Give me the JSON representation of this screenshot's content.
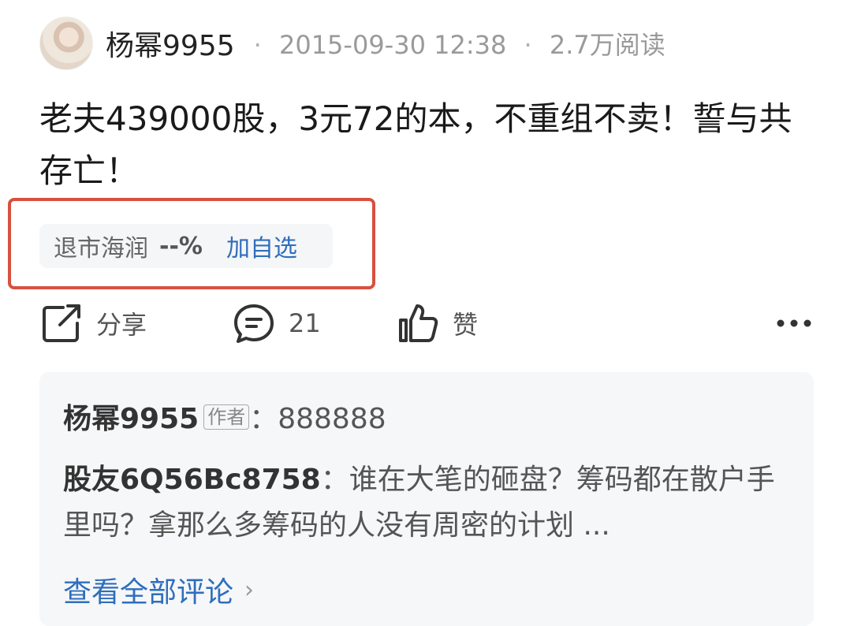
{
  "header": {
    "author": "杨幂9955",
    "separator": "·",
    "timestamp": "2015-09-30 12:38",
    "views": "2.7万阅读"
  },
  "post": {
    "text": "老夫439000股，3元72的本，不重组不卖！誓与共存亡！"
  },
  "stock": {
    "name": "退市海润",
    "change": "--%",
    "add_label": "加自选"
  },
  "actions": {
    "share_label": "分享",
    "comment_count": "21",
    "like_label": "赞"
  },
  "comments": {
    "items": [
      {
        "user": "杨幂9955",
        "tag": "作者",
        "separator": "：",
        "text": "888888"
      },
      {
        "user": "股友6Q56Bc8758",
        "separator": "：",
        "text": "谁在大笔的砸盘？筹码都在散户手里吗？拿那么多筹码的人没有周密的计划 ..."
      }
    ],
    "view_all": "查看全部评论"
  },
  "colors": {
    "highlight_border": "#d8503f",
    "link": "#2f6ebb"
  }
}
